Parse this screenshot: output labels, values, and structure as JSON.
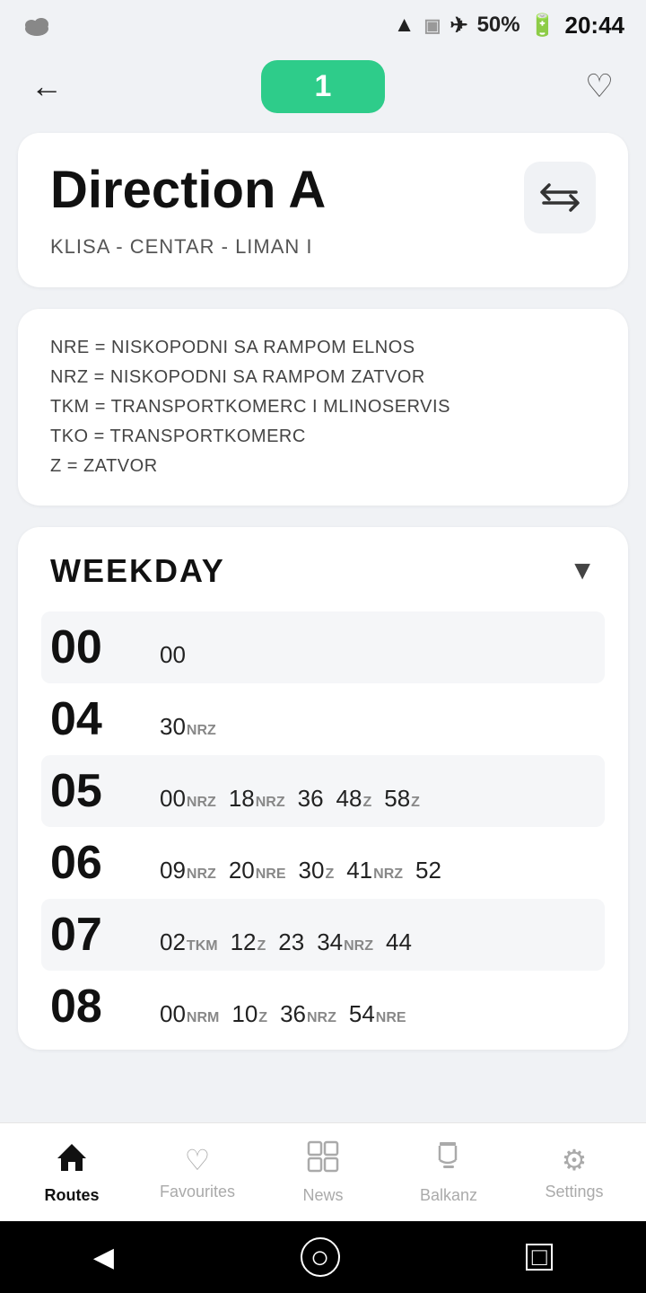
{
  "statusBar": {
    "battery": "50%",
    "time": "20:44"
  },
  "topNav": {
    "badgeNumber": "1",
    "backLabel": "←",
    "heartLabel": "♡"
  },
  "directionCard": {
    "title": "Direction A",
    "subtitle": "KLISA - CENTAR - LIMAN I",
    "swapIcon": "⇇"
  },
  "legendCard": {
    "items": [
      "NRE = NISKOPODNI SA RAMPOM ELNOS",
      "NRZ = NISKOPODNI SA RAMPOM ZATVOR",
      "TKM = TRANSPORTKOMERC I MLINOSERVIS",
      "TKO = TRANSPORTKOMERC",
      "Z = ZATVOR"
    ]
  },
  "scheduleCard": {
    "title": "WEEKDAY",
    "rows": [
      {
        "hour": "00",
        "minutes": [
          {
            "num": "00",
            "sup": ""
          }
        ]
      },
      {
        "hour": "04",
        "minutes": [
          {
            "num": "30",
            "sup": "NRZ"
          }
        ]
      },
      {
        "hour": "05",
        "minutes": [
          {
            "num": "00",
            "sup": "NRZ"
          },
          {
            "num": "18",
            "sup": "NRZ"
          },
          {
            "num": "36",
            "sup": ""
          },
          {
            "num": "48",
            "sup": "Z"
          },
          {
            "num": "58",
            "sup": "Z"
          }
        ]
      },
      {
        "hour": "06",
        "minutes": [
          {
            "num": "09",
            "sup": "NRZ"
          },
          {
            "num": "20",
            "sup": "NRE"
          },
          {
            "num": "30",
            "sup": "Z"
          },
          {
            "num": "41",
            "sup": "NRZ"
          },
          {
            "num": "52",
            "sup": ""
          }
        ]
      },
      {
        "hour": "07",
        "minutes": [
          {
            "num": "02",
            "sup": "TKM"
          },
          {
            "num": "12",
            "sup": "Z"
          },
          {
            "num": "23",
            "sup": ""
          },
          {
            "num": "34",
            "sup": "NRZ"
          },
          {
            "num": "44",
            "sup": ""
          }
        ]
      },
      {
        "hour": "08",
        "minutes": [
          {
            "num": "00",
            "sup": "NRM"
          },
          {
            "num": "10",
            "sup": "Z"
          },
          {
            "num": "36",
            "sup": "NRZ"
          },
          {
            "num": "54",
            "sup": "NRE"
          }
        ]
      }
    ]
  },
  "bottomNav": {
    "items": [
      {
        "id": "routes",
        "label": "Routes",
        "icon": "⌂",
        "active": true
      },
      {
        "id": "favourites",
        "label": "Favourites",
        "icon": "♡",
        "active": false
      },
      {
        "id": "news",
        "label": "News",
        "icon": "▦",
        "active": false
      },
      {
        "id": "balkanz",
        "label": "Balkanz",
        "icon": "☕",
        "active": false
      },
      {
        "id": "settings",
        "label": "Settings",
        "icon": "⚙",
        "active": false
      }
    ]
  }
}
